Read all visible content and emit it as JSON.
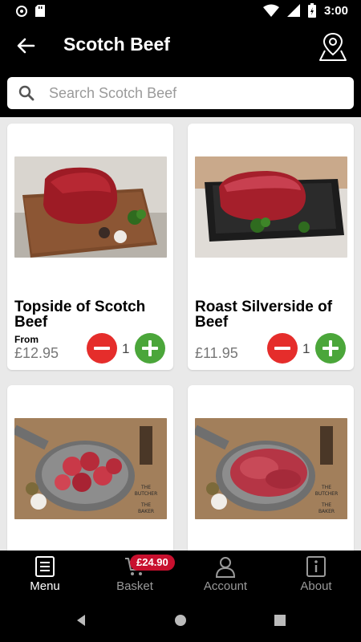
{
  "status_bar": {
    "time": "3:00",
    "icons": [
      "sync-icon",
      "sd-card-icon",
      "wifi-icon",
      "battery-charging-icon"
    ]
  },
  "app_bar": {
    "title": "Scotch Beef",
    "back_icon": "arrow-back-icon",
    "action_icon": "map-pin-icon"
  },
  "search": {
    "placeholder": "Search Scotch Beef"
  },
  "products": [
    {
      "name": "Topside of Scotch Beef",
      "from_label": "From",
      "price": "£12.95",
      "quantity": "1",
      "image": "topside-beef-on-board"
    },
    {
      "name": "Roast Silverside of Beef",
      "from_label": "",
      "price": "£11.95",
      "quantity": "1",
      "image": "silverside-beef-in-tray"
    },
    {
      "name": "",
      "image": "diced-beef-in-scoop",
      "image_text": [
        "THE",
        "BUTCHER",
        "THE",
        "BAKER"
      ]
    },
    {
      "name": "",
      "image": "minced-beef-in-scoop",
      "image_text": [
        "THE",
        "BUTCHER",
        "THE",
        "BAKER"
      ]
    }
  ],
  "bottom_nav": {
    "items": [
      {
        "label": "Menu",
        "icon": "menu-book-icon",
        "active": true
      },
      {
        "label": "Basket",
        "icon": "basket-icon",
        "active": false
      },
      {
        "label": "Account",
        "icon": "account-icon",
        "active": false
      },
      {
        "label": "About",
        "icon": "info-icon",
        "active": false
      }
    ],
    "basket_total": "£24.90"
  },
  "colors": {
    "minus": "#e52d2b",
    "plus": "#4ba63a",
    "badge": "#c8102e",
    "bar": "#000000"
  }
}
